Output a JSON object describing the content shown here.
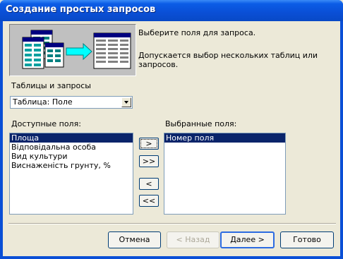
{
  "window": {
    "title": "Создание простых запросов"
  },
  "description": {
    "line1": "Выберите поля для запроса.",
    "line2": "Допускается выбор нескольких таблиц или запросов."
  },
  "tables": {
    "label": "Таблицы и запросы",
    "selected": "Таблица: Поле"
  },
  "available": {
    "label": "Доступные поля:",
    "items": [
      "Площа",
      "Відповідальна особа",
      "Вид культури",
      "Виснаженість грунту, %"
    ]
  },
  "selected_fields": {
    "label": "Выбранные поля:",
    "items": [
      "Номер поля"
    ]
  },
  "move_buttons": {
    "add_one": ">",
    "add_all": ">>",
    "remove_one": "<",
    "remove_all": "<<"
  },
  "footer": {
    "cancel": "Отмена",
    "back": "< Назад",
    "next": "Далее >",
    "finish": "Готово"
  },
  "colors": {
    "titlebar": "#0A4FD6",
    "selection": "#0A246A",
    "dialog_bg": "#ECE9D8"
  }
}
